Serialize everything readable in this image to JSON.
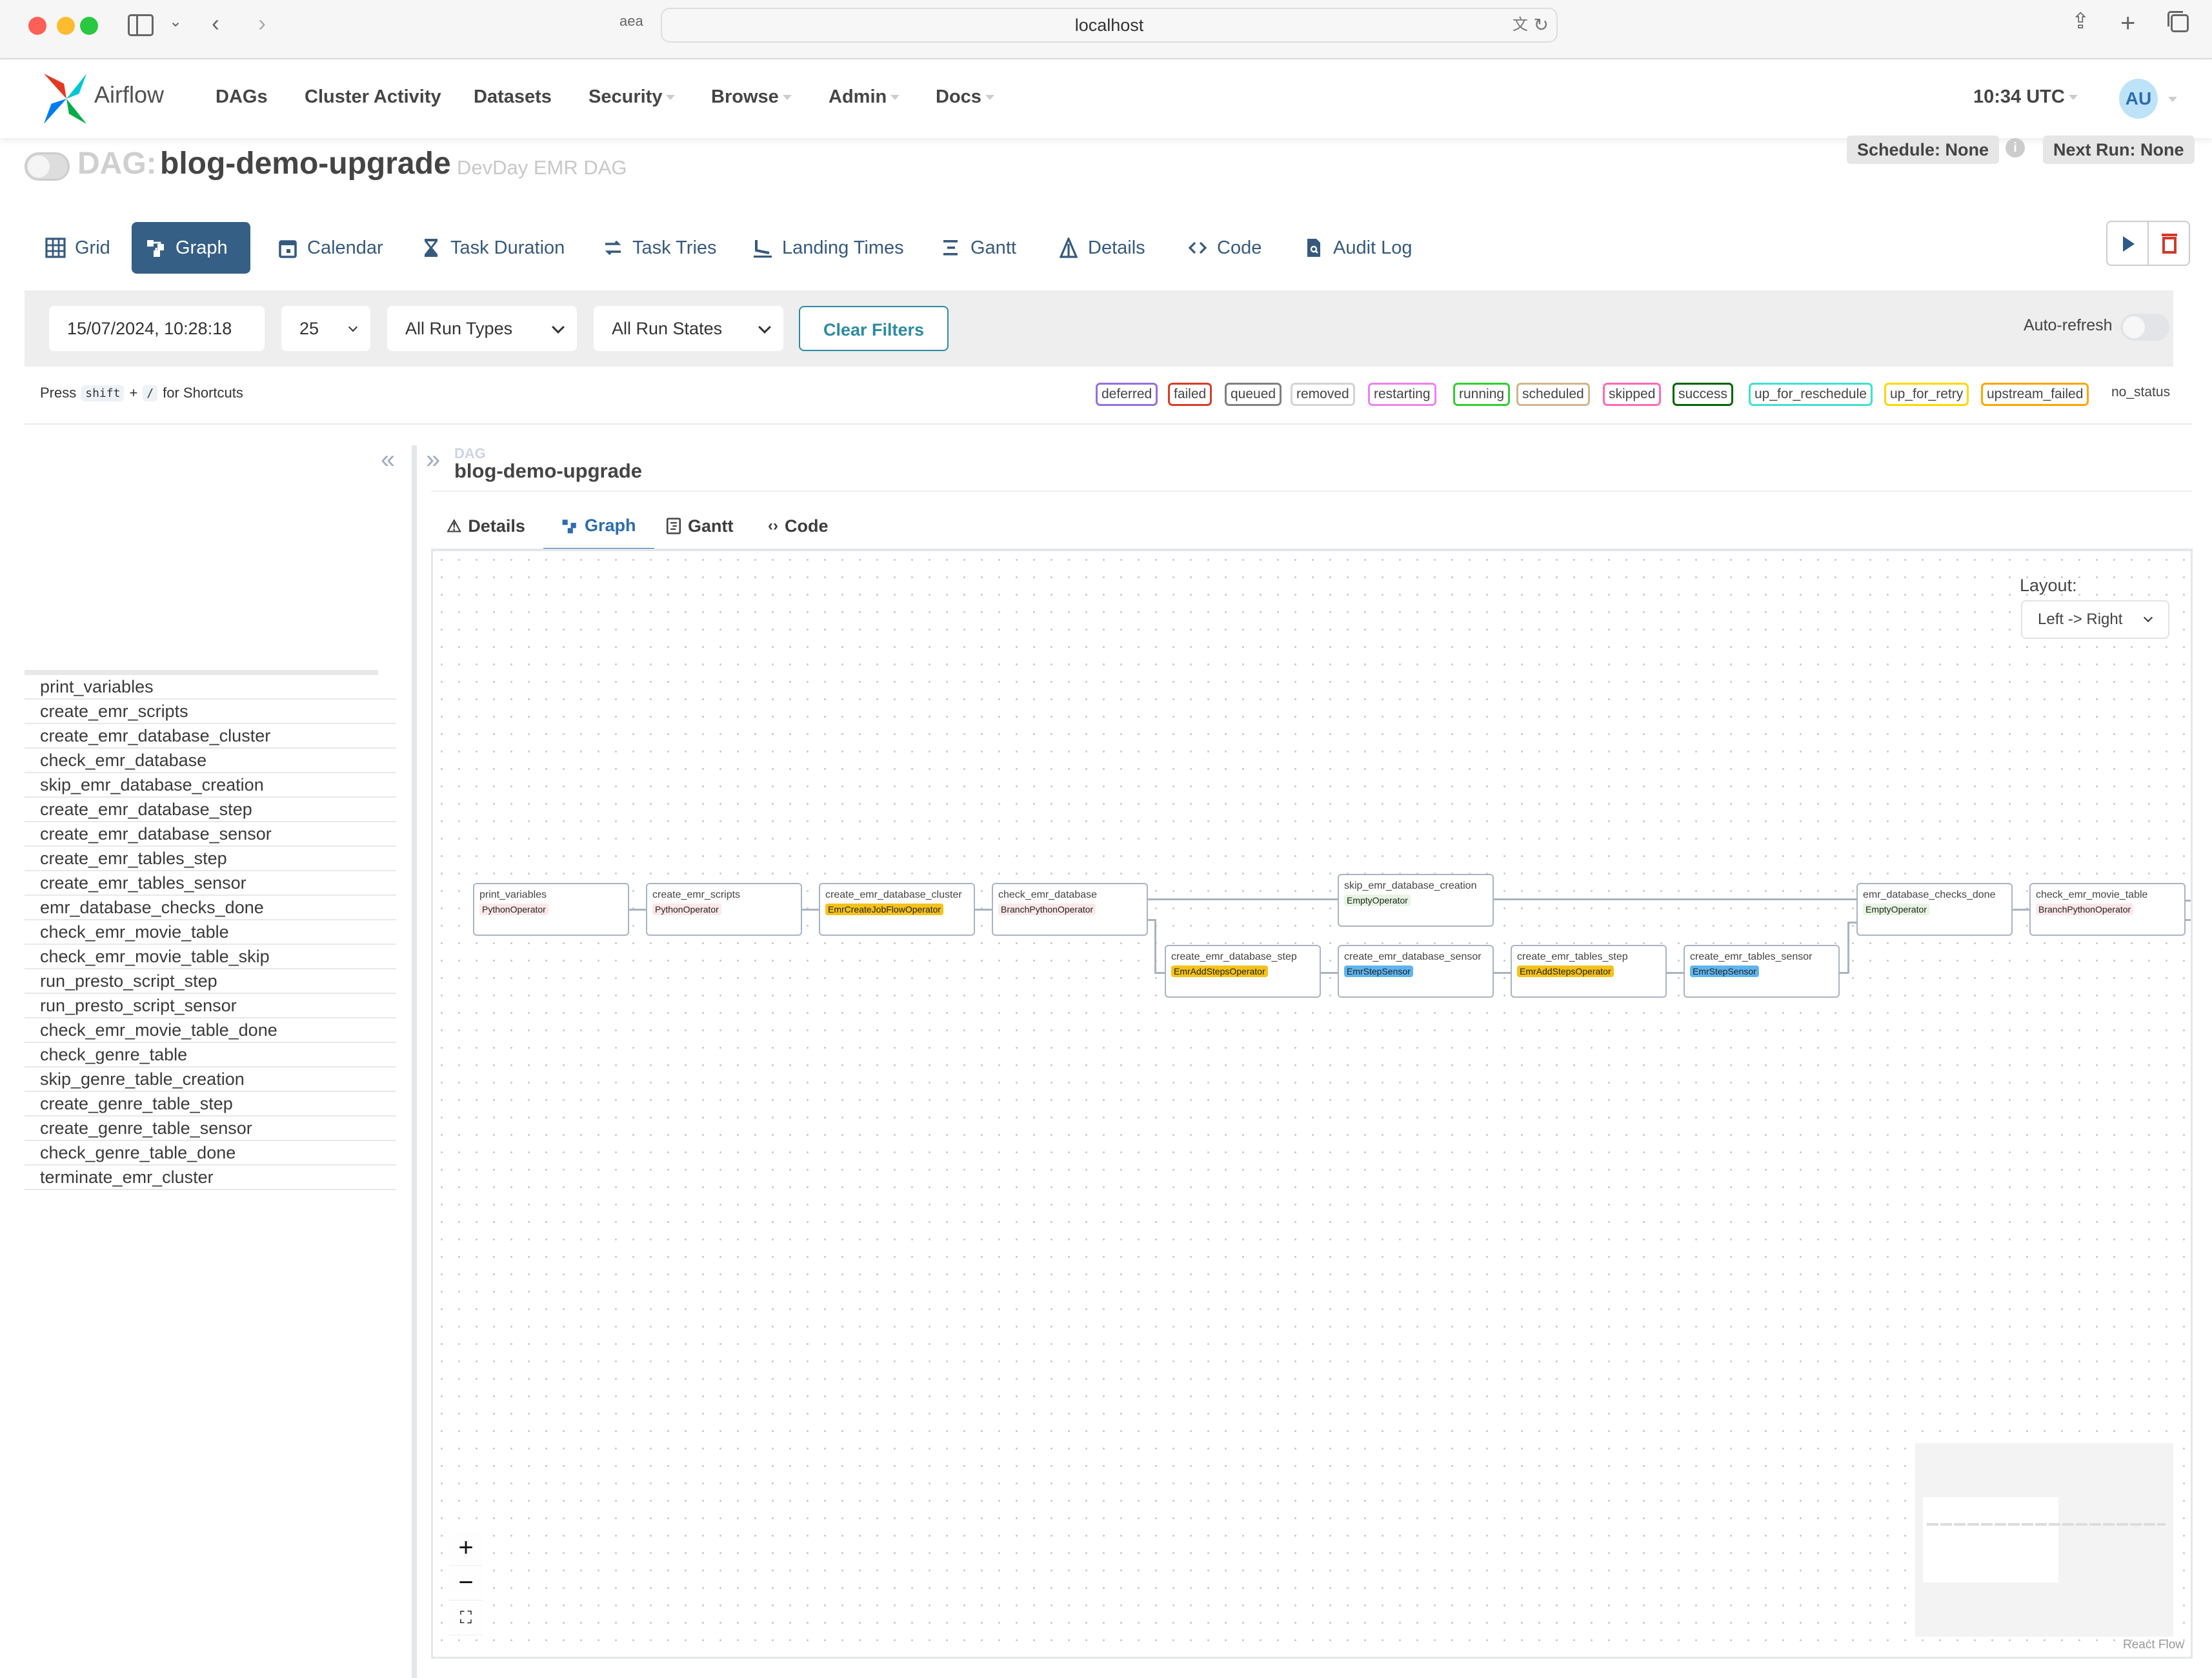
{
  "browser": {
    "url": "localhost",
    "reader_icon": "aea",
    "icons": [
      "sidebar-icon",
      "chevron-down-icon",
      "back-icon",
      "forward-icon",
      "translate-icon",
      "reload-icon",
      "share-icon",
      "new-tab-icon",
      "tabs-overview-icon"
    ]
  },
  "nav": {
    "brand": "Airflow",
    "items": [
      {
        "label": "DAGs",
        "dropdown": false
      },
      {
        "label": "Cluster Activity",
        "dropdown": false
      },
      {
        "label": "Datasets",
        "dropdown": false
      },
      {
        "label": "Security",
        "dropdown": true
      },
      {
        "label": "Browse",
        "dropdown": true
      },
      {
        "label": "Admin",
        "dropdown": true
      },
      {
        "label": "Docs",
        "dropdown": true
      }
    ],
    "time": "10:34 UTC",
    "user_initials": "AU"
  },
  "dag": {
    "prefix": "DAG:",
    "id": "blog-demo-upgrade",
    "description": "DevDay EMR DAG",
    "paused": true,
    "schedule": "Schedule: None",
    "next_run": "Next Run: None"
  },
  "views": [
    {
      "label": "Grid",
      "icon": "grid-icon",
      "active": false
    },
    {
      "label": "Graph",
      "icon": "graph-icon",
      "active": true
    },
    {
      "label": "Calendar",
      "icon": "calendar-icon",
      "active": false
    },
    {
      "label": "Task Duration",
      "icon": "hourglass-icon",
      "active": false
    },
    {
      "label": "Task Tries",
      "icon": "retry-icon",
      "active": false
    },
    {
      "label": "Landing Times",
      "icon": "plane-landing-icon",
      "active": false
    },
    {
      "label": "Gantt",
      "icon": "gantt-icon",
      "active": false
    },
    {
      "label": "Details",
      "icon": "details-icon",
      "active": false
    },
    {
      "label": "Code",
      "icon": "code-icon",
      "active": false
    },
    {
      "label": "Audit Log",
      "icon": "audit-log-icon",
      "active": false
    }
  ],
  "actions": {
    "trigger": "play-icon",
    "delete": "trash-icon"
  },
  "filters": {
    "base_date": "15/07/2024, 10:28:18",
    "num_runs": "25",
    "run_type": "All Run Types",
    "run_state": "All Run States",
    "clear_label": "Clear Filters",
    "auto_refresh_label": "Auto-refresh",
    "auto_refresh": false
  },
  "shortcuts": {
    "press": "Press",
    "key1": "shift",
    "plus": "+",
    "key2": "/",
    "suffix": "for Shortcuts"
  },
  "legend": [
    {
      "label": "deferred",
      "color": "#9370db"
    },
    {
      "label": "failed",
      "color": "#d63d28"
    },
    {
      "label": "queued",
      "color": "#808080"
    },
    {
      "label": "removed",
      "color": "#d3d3d3"
    },
    {
      "label": "restarting",
      "color": "#ee82ee"
    },
    {
      "label": "running",
      "color": "#32cd32"
    },
    {
      "label": "scheduled",
      "color": "#d2b48c"
    },
    {
      "label": "skipped",
      "color": "#ff69b4"
    },
    {
      "label": "success",
      "color": "#006400"
    },
    {
      "label": "up_for_reschedule",
      "color": "#40e0d0"
    },
    {
      "label": "up_for_retry",
      "color": "#ffd700"
    },
    {
      "label": "upstream_failed",
      "color": "#ffa500"
    },
    {
      "label": "no_status",
      "color": ""
    }
  ],
  "tasks": [
    "print_variables",
    "create_emr_scripts",
    "create_emr_database_cluster",
    "check_emr_database",
    "skip_emr_database_creation",
    "create_emr_database_step",
    "create_emr_database_sensor",
    "create_emr_tables_step",
    "create_emr_tables_sensor",
    "emr_database_checks_done",
    "check_emr_movie_table",
    "check_emr_movie_table_skip",
    "run_presto_script_step",
    "run_presto_script_sensor",
    "check_emr_movie_table_done",
    "check_genre_table",
    "skip_genre_table_creation",
    "create_genre_table_step",
    "create_genre_table_sensor",
    "check_genre_table_done",
    "terminate_emr_cluster"
  ],
  "detail_panel": {
    "label": "DAG",
    "dag_id": "blog-demo-upgrade",
    "tabs": [
      {
        "label": "Details",
        "icon": "details-icon",
        "active": false
      },
      {
        "label": "Graph",
        "icon": "graph-icon",
        "active": true
      },
      {
        "label": "Gantt",
        "icon": "gantt-icon",
        "active": false
      },
      {
        "label": "Code",
        "icon": "code-icon",
        "active": false
      }
    ]
  },
  "graph": {
    "layout_label": "Layout:",
    "layout_value": "Left -> Right",
    "attribution": "React Flow",
    "nodes": [
      {
        "id": "print_variables",
        "operator": "PythonOperator",
        "op_color": "#fde8e8"
      },
      {
        "id": "create_emr_scripts",
        "operator": "PythonOperator",
        "op_color": "#fde8e8"
      },
      {
        "id": "create_emr_database_cluster",
        "operator": "EmrCreateJobFlowOperator",
        "op_color": "#f4c21b"
      },
      {
        "id": "check_emr_database",
        "operator": "BranchPythonOperator",
        "op_color": "#fde8e8"
      },
      {
        "id": "skip_emr_database_creation",
        "operator": "EmptyOperator",
        "op_color": "#e6f5e1"
      },
      {
        "id": "create_emr_database_step",
        "operator": "EmrAddStepsOperator",
        "op_color": "#f4c21b"
      },
      {
        "id": "create_emr_database_sensor",
        "operator": "EmrStepSensor",
        "op_color": "#5fb5ef"
      },
      {
        "id": "create_emr_tables_step",
        "operator": "EmrAddStepsOperator",
        "op_color": "#f4c21b"
      },
      {
        "id": "create_emr_tables_sensor",
        "operator": "EmrStepSensor",
        "op_color": "#5fb5ef"
      },
      {
        "id": "emr_database_checks_done",
        "operator": "EmptyOperator",
        "op_color": "#e6f5e1"
      },
      {
        "id": "check_emr_movie_table",
        "operator": "BranchPythonOperator",
        "op_color": "#fde8e8"
      }
    ]
  }
}
